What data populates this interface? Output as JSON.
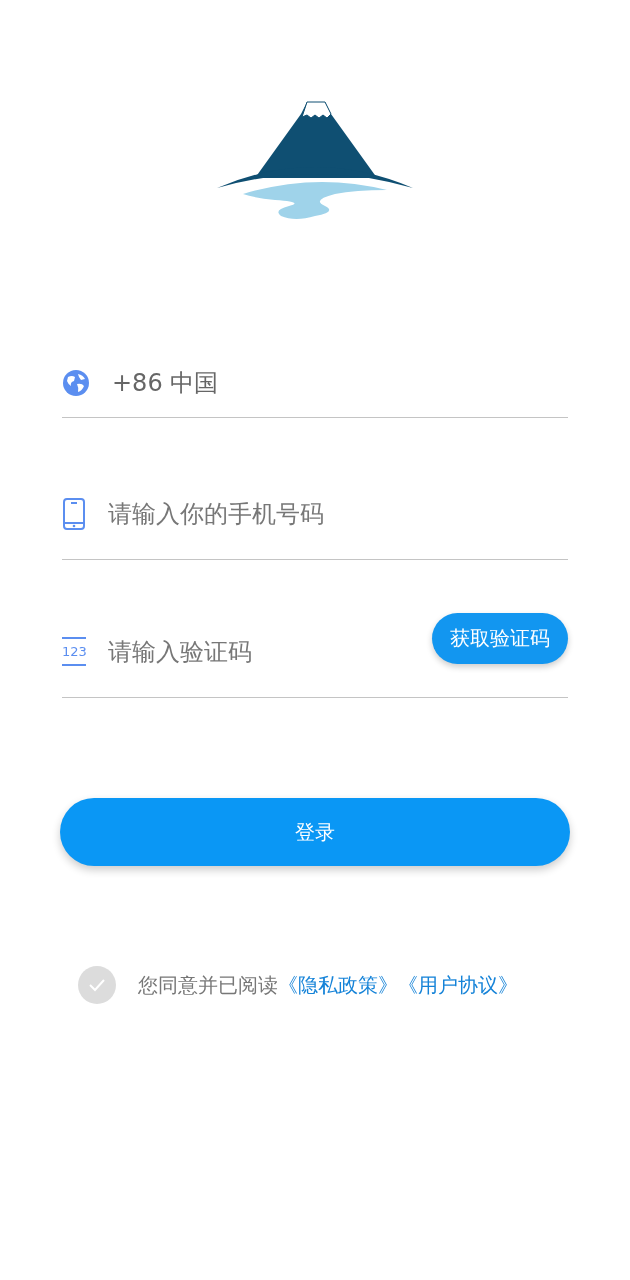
{
  "country_field": {
    "value": "+86 中国"
  },
  "phone_field": {
    "placeholder": "请输入你的手机号码"
  },
  "code_field": {
    "placeholder": "请输入验证码",
    "icon_text": "123",
    "button": "获取验证码"
  },
  "login_button": "登录",
  "agreement": {
    "checked": false,
    "text": "您同意并已阅读",
    "links": [
      "《隐私政策》",
      "《用户协议》"
    ]
  }
}
